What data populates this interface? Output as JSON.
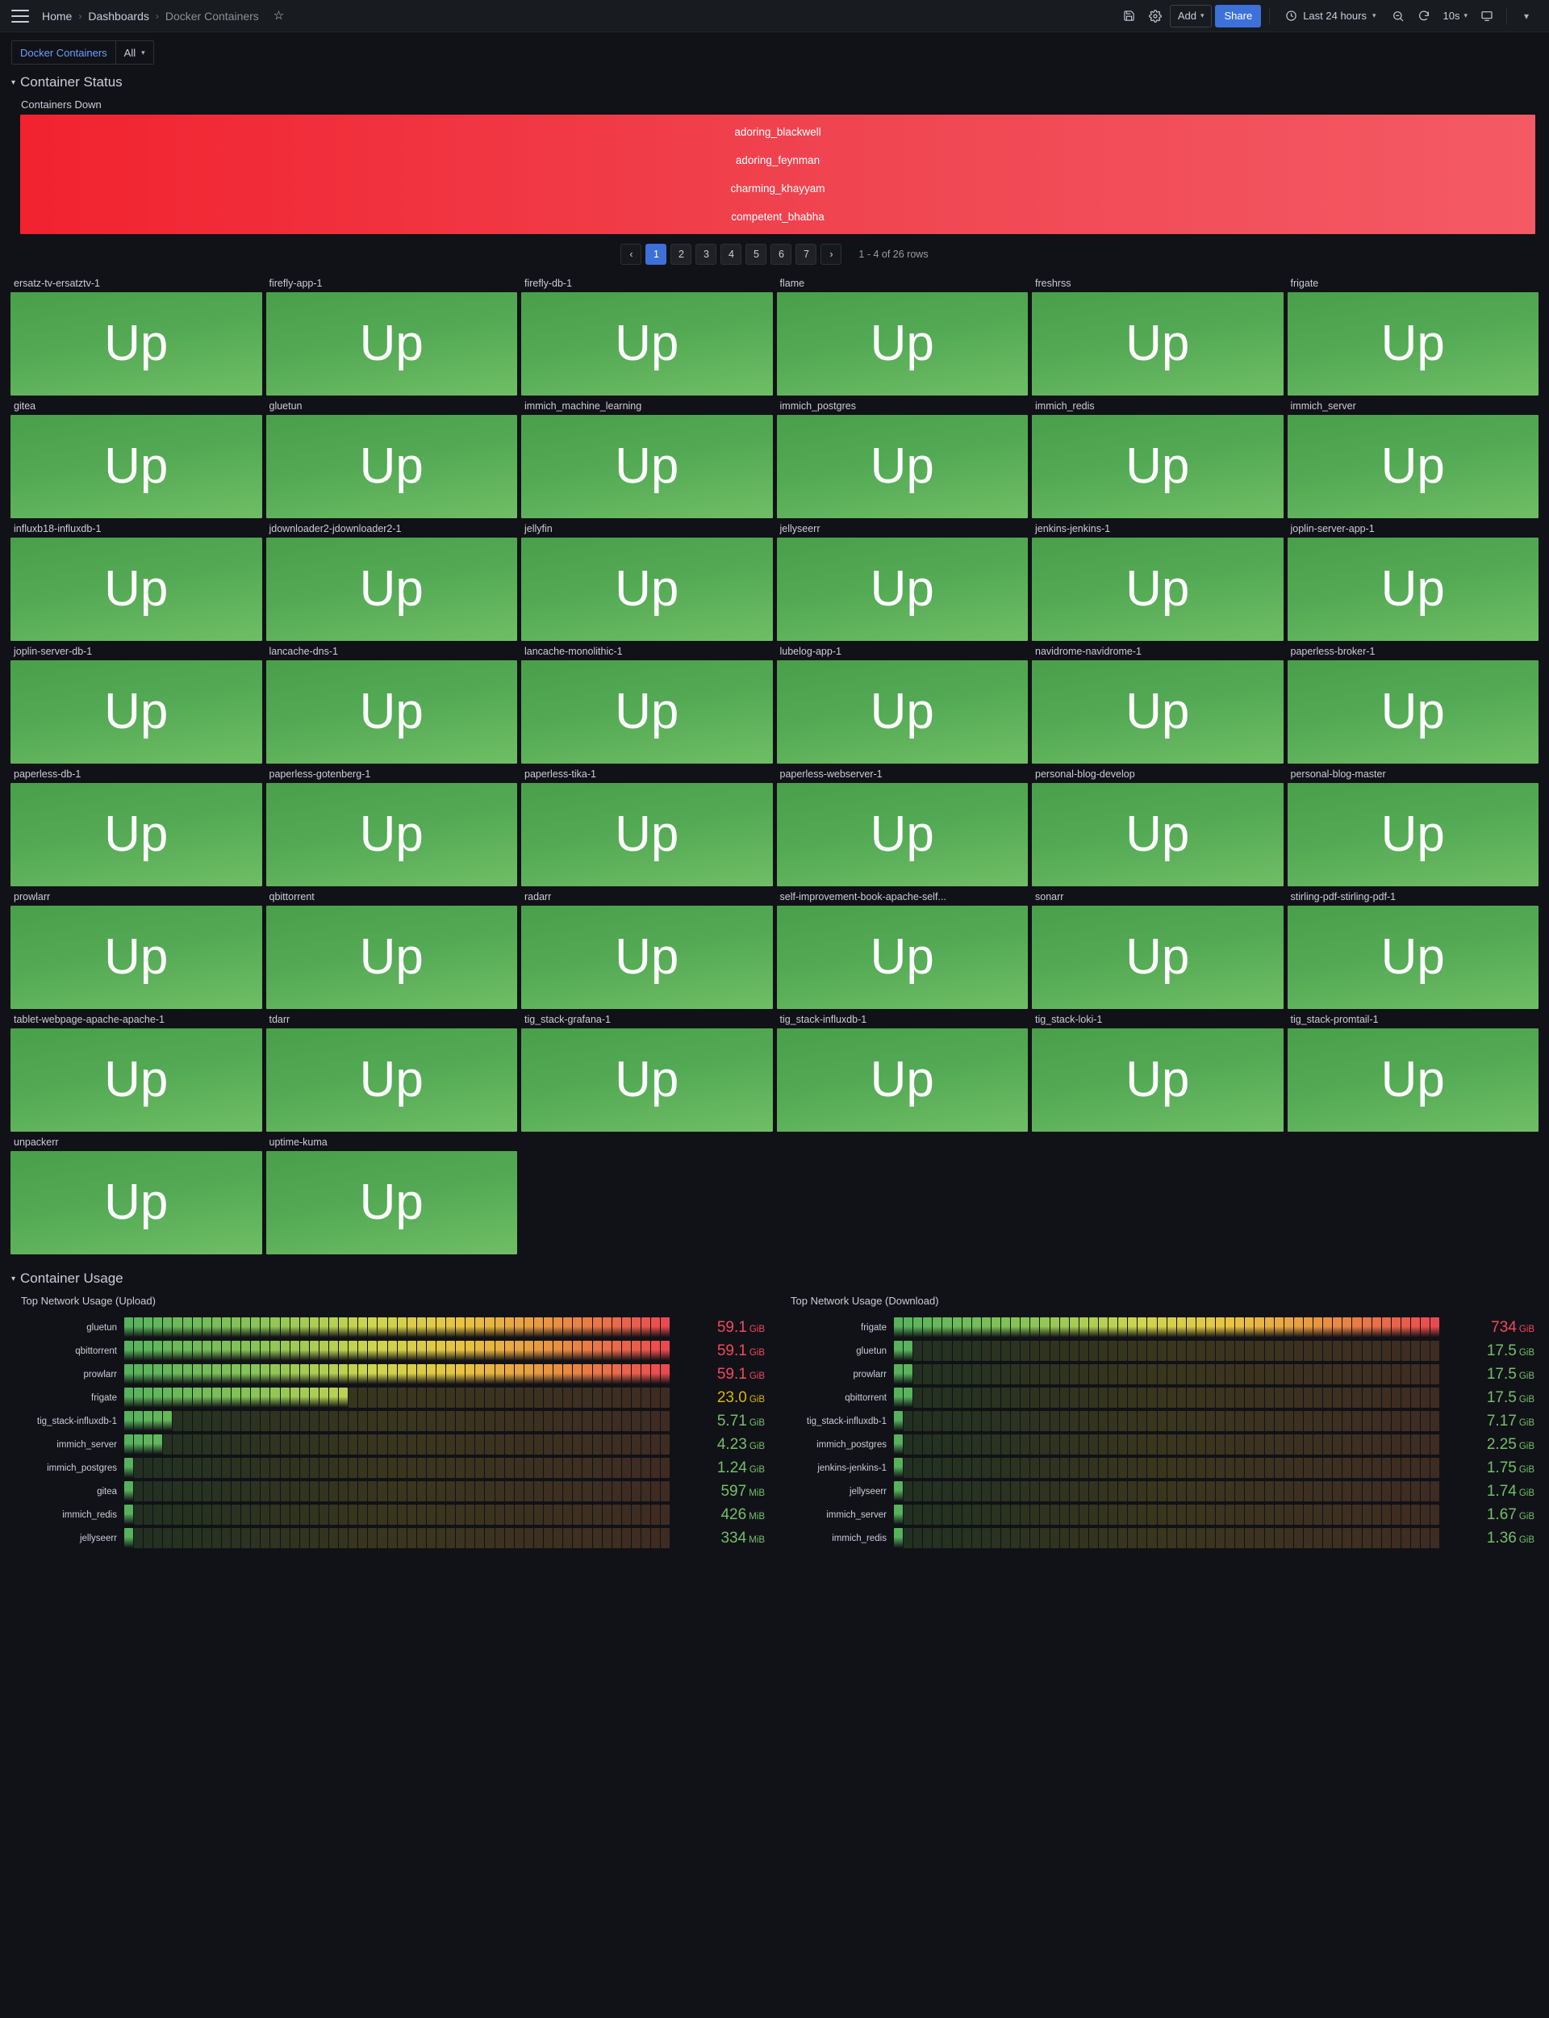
{
  "topbar": {
    "menu_icon": "hamburger-icon",
    "breadcrumb": [
      "Home",
      "Dashboards",
      "Docker Containers"
    ],
    "star_icon": "star-icon",
    "save_icon": "save-icon",
    "settings_icon": "gear-icon",
    "add_label": "Add",
    "share_label": "Share",
    "time_range": "Last 24 hours",
    "zoom_out_icon": "zoom-out-icon",
    "refresh_icon": "refresh-icon",
    "refresh_interval": "10s",
    "kiosk_icon": "tv-icon",
    "more_icon": "chevron-down-icon"
  },
  "variables": [
    {
      "label": "Docker Containers",
      "value": "All"
    }
  ],
  "rows": [
    {
      "title": "Container Status"
    },
    {
      "title": "Container Usage"
    }
  ],
  "containers_down": {
    "title": "Containers Down",
    "items": [
      "adoring_blackwell",
      "adoring_feynman",
      "charming_khayyam",
      "competent_bhabha"
    ],
    "color": "#f0434f"
  },
  "pagination": {
    "prev": "‹",
    "pages": [
      "1",
      "2",
      "3",
      "4",
      "5",
      "6",
      "7"
    ],
    "active": "1",
    "next": "›",
    "info": "1 - 4 of 26 rows"
  },
  "status_value": "Up",
  "status_color": "#53a954",
  "containers": [
    "ersatz-tv-ersatztv-1",
    "firefly-app-1",
    "firefly-db-1",
    "flame",
    "freshrss",
    "frigate",
    "gitea",
    "gluetun",
    "immich_machine_learning",
    "immich_postgres",
    "immich_redis",
    "immich_server",
    "influxb18-influxdb-1",
    "jdownloader2-jdownloader2-1",
    "jellyfin",
    "jellyseerr",
    "jenkins-jenkins-1",
    "joplin-server-app-1",
    "joplin-server-db-1",
    "lancache-dns-1",
    "lancache-monolithic-1",
    "lubelog-app-1",
    "navidrome-navidrome-1",
    "paperless-broker-1",
    "paperless-db-1",
    "paperless-gotenberg-1",
    "paperless-tika-1",
    "paperless-webserver-1",
    "personal-blog-develop",
    "personal-blog-master",
    "prowlarr",
    "qbittorrent",
    "radarr",
    "self-improvement-book-apache-self...",
    "sonarr",
    "stirling-pdf-stirling-pdf-1",
    "tablet-webpage-apache-apache-1",
    "tdarr",
    "tig_stack-grafana-1",
    "tig_stack-influxdb-1",
    "tig_stack-loki-1",
    "tig_stack-promtail-1",
    "unpackerr",
    "uptime-kuma"
  ],
  "chart_data": [
    {
      "type": "heatmap",
      "title": "Top Network Usage (Upload)",
      "xlabel": "",
      "ylabel": "",
      "legend": "none",
      "grid": false,
      "categories": [
        "gluetun",
        "qbittorrent",
        "prowlarr",
        "frigate",
        "tig_stack-influxdb-1",
        "immich_server",
        "immich_postgres",
        "gitea",
        "immich_redis",
        "jellyseerr"
      ],
      "values": [
        59.1,
        59.1,
        59.1,
        23.0,
        5.71,
        4.23,
        1.24,
        597,
        426,
        334
      ],
      "value_labels": [
        "59.1",
        "59.1",
        "59.1",
        "23.0",
        "5.71",
        "4.23",
        "1.24",
        "597",
        "426",
        "334"
      ],
      "units": [
        "GiB",
        "GiB",
        "GiB",
        "GiB",
        "GiB",
        "GiB",
        "GiB",
        "MiB",
        "MiB",
        "MiB"
      ],
      "value_colors": [
        "#f2495c",
        "#f2495c",
        "#f2495c",
        "#e0b400",
        "#73bf69",
        "#73bf69",
        "#73bf69",
        "#73bf69",
        "#73bf69",
        "#73bf69"
      ],
      "fill_fraction": [
        1.0,
        1.0,
        1.0,
        0.41,
        0.09,
        0.07,
        0.02,
        0.02,
        0.015,
        0.012
      ],
      "columns": 56
    },
    {
      "type": "heatmap",
      "title": "Top Network Usage (Download)",
      "xlabel": "",
      "ylabel": "",
      "legend": "none",
      "grid": false,
      "categories": [
        "frigate",
        "gluetun",
        "prowlarr",
        "qbittorrent",
        "tig_stack-influxdb-1",
        "immich_postgres",
        "jenkins-jenkins-1",
        "jellyseerr",
        "immich_server",
        "immich_redis"
      ],
      "values": [
        734,
        17.5,
        17.5,
        17.5,
        7.17,
        2.25,
        1.75,
        1.74,
        1.67,
        1.36
      ],
      "value_labels": [
        "734",
        "17.5",
        "17.5",
        "17.5",
        "7.17",
        "2.25",
        "1.75",
        "1.74",
        "1.67",
        "1.36"
      ],
      "units": [
        "GiB",
        "GiB",
        "GiB",
        "GiB",
        "GiB",
        "GiB",
        "GiB",
        "GiB",
        "GiB",
        "GiB"
      ],
      "value_colors": [
        "#f2495c",
        "#73bf69",
        "#73bf69",
        "#73bf69",
        "#73bf69",
        "#73bf69",
        "#73bf69",
        "#73bf69",
        "#73bf69",
        "#73bf69"
      ],
      "fill_fraction": [
        1.0,
        0.035,
        0.035,
        0.035,
        0.018,
        0.013,
        0.012,
        0.012,
        0.012,
        0.011
      ],
      "columns": 56
    }
  ]
}
